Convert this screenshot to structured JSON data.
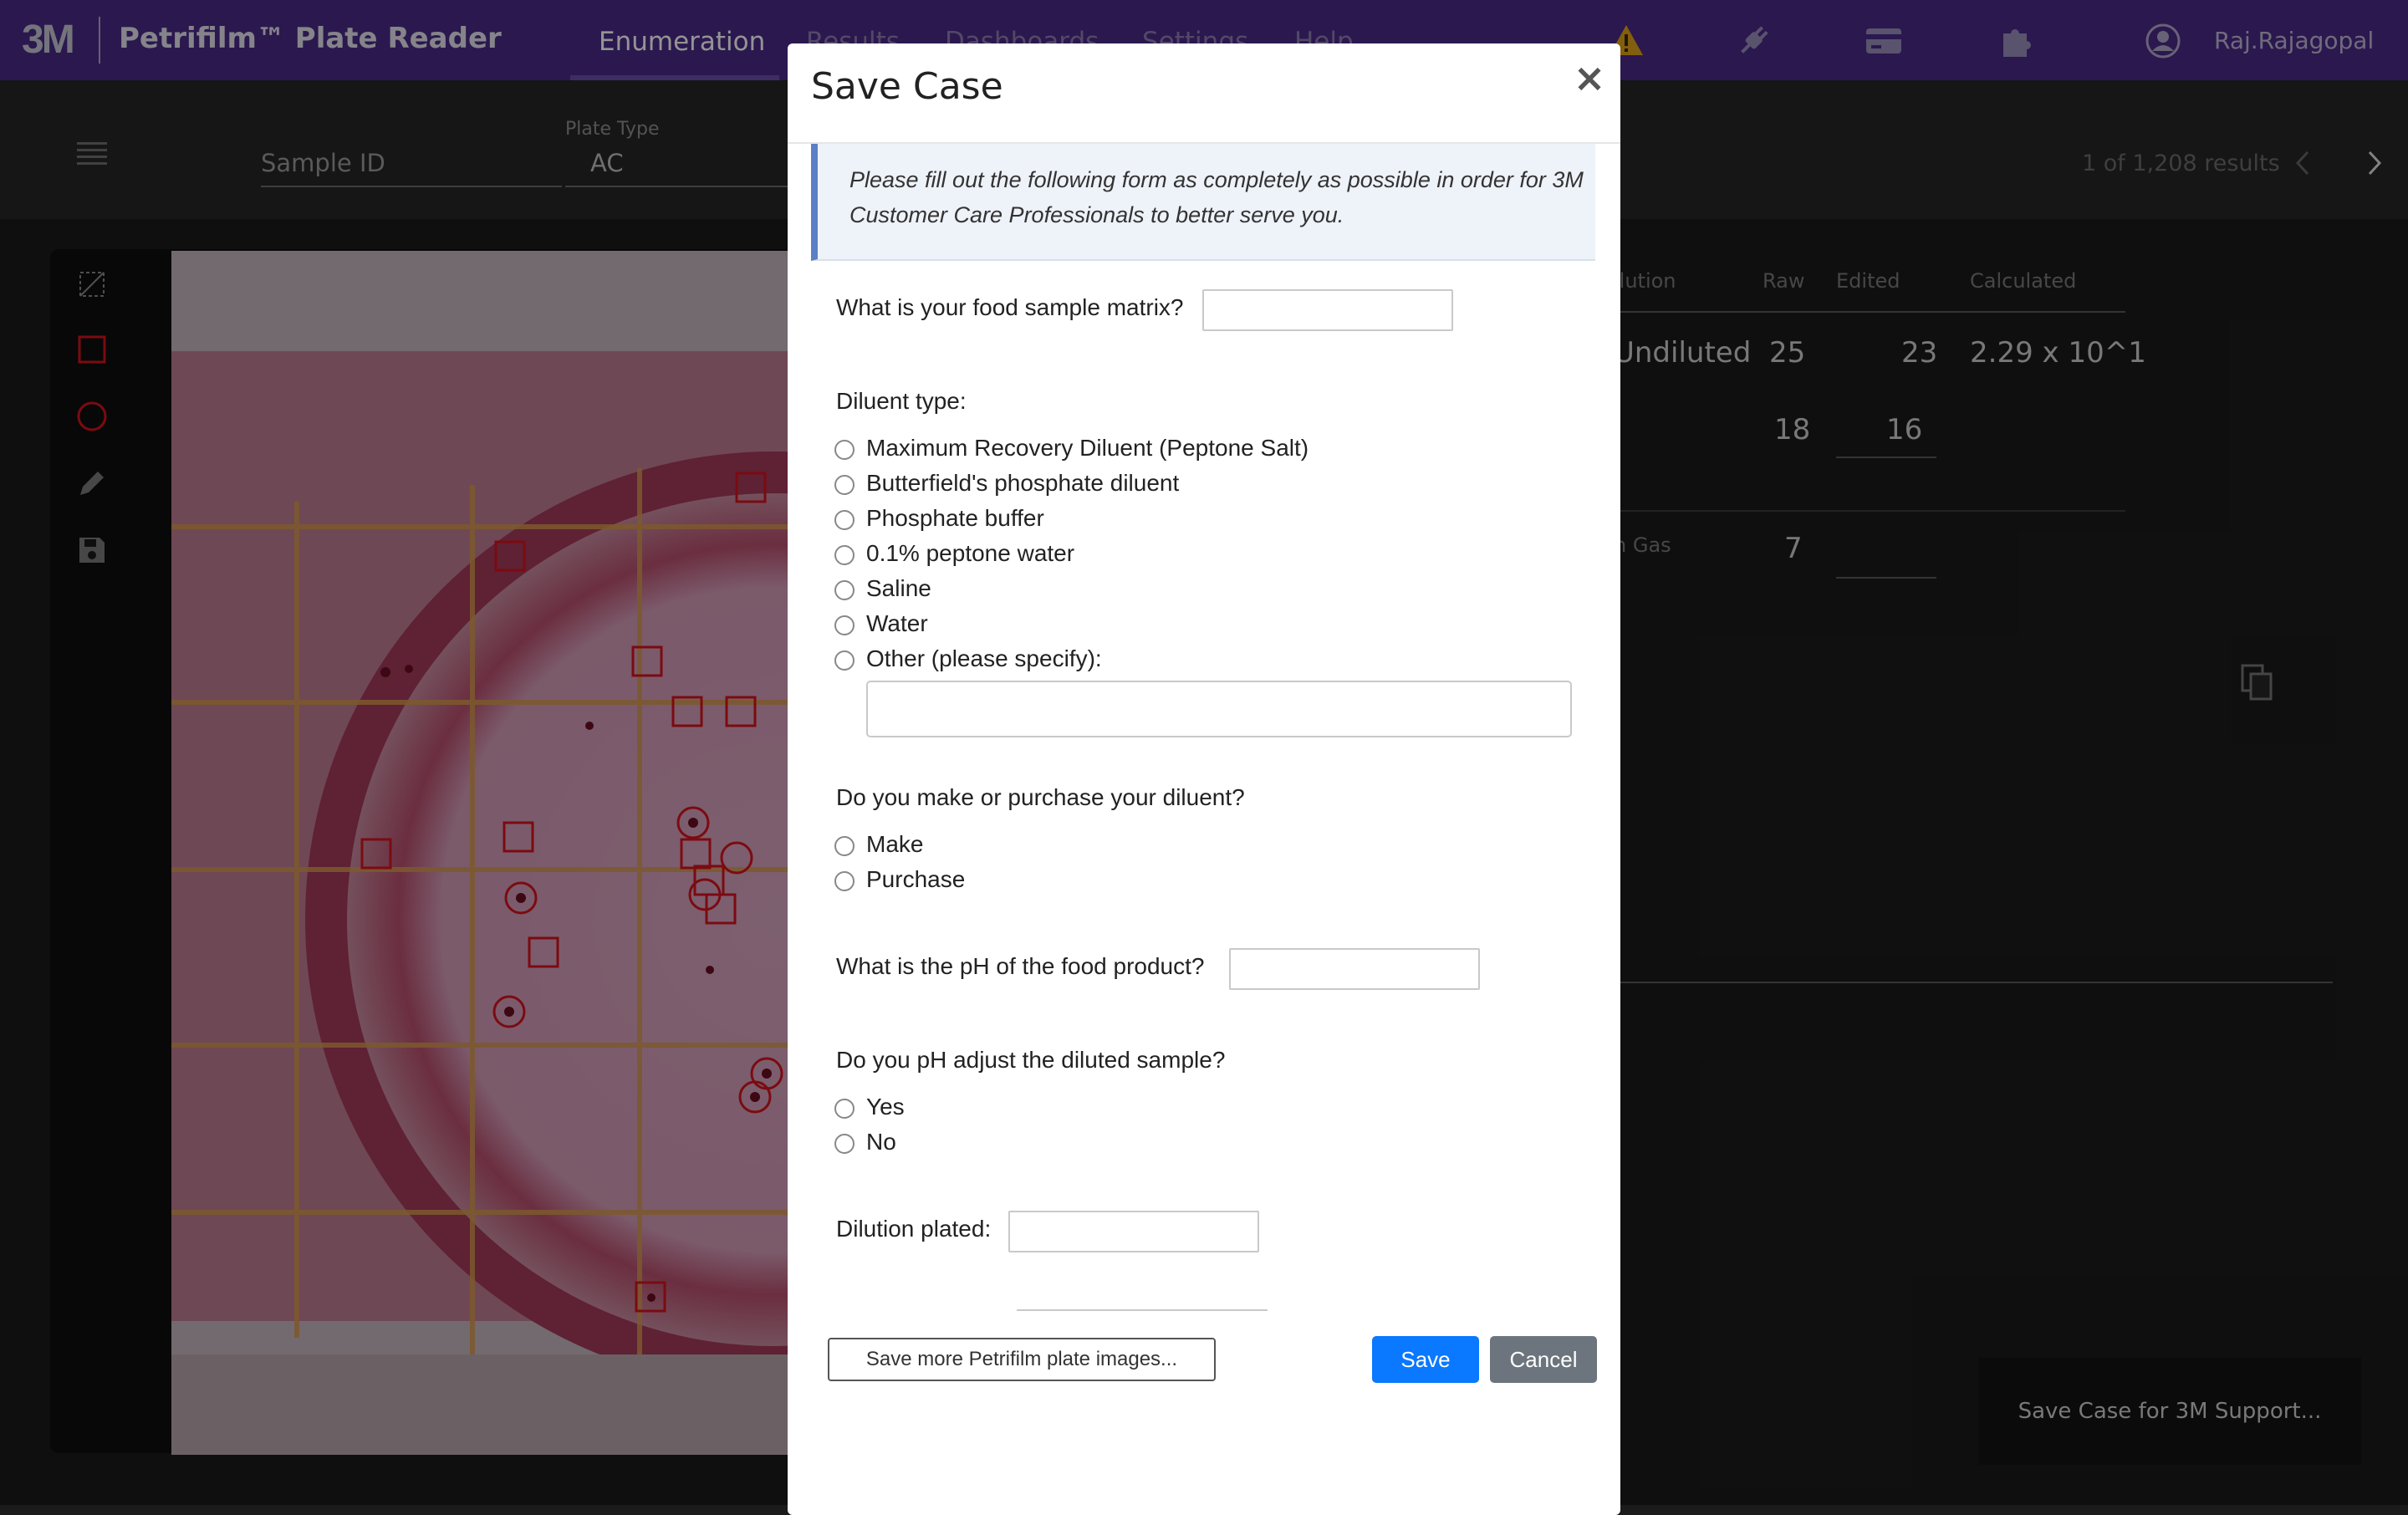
{
  "header": {
    "brand": "3M",
    "app_title": "Petrifilm™ Plate Reader",
    "nav": [
      "Enumeration",
      "Results",
      "Dashboards",
      "Settings",
      "Help"
    ],
    "active_nav": "Enumeration",
    "user": "Raj.Rajagopal",
    "icons": [
      "warning-icon",
      "plug-icon",
      "card-icon",
      "puzzle-icon",
      "user-circle-icon"
    ]
  },
  "toolbar": {
    "sample_id_placeholder": "Sample ID",
    "plate_type_label": "Plate Type",
    "plate_type_value": "AC",
    "results_count": "1 of 1,208 results"
  },
  "background_table": {
    "headers": [
      "ilution",
      "Raw",
      "Edited",
      "Calculated"
    ],
    "row1": {
      "dilution": "Undiluted",
      "raw": "25",
      "edited": "23",
      "calculated": "2.29 x 10^1"
    },
    "row2": {
      "raw": "18",
      "edited": "16"
    },
    "row3": {
      "label": "h Gas",
      "raw": "7"
    },
    "save_case_button": "Save Case for 3M Support..."
  },
  "modal": {
    "title": "Save Case",
    "close_glyph": "×",
    "notice": "Please fill out the following form as completely as possible in order for 3M Customer Care Professionals to better serve you.",
    "q_matrix": "What is your food sample matrix?",
    "q_diluent_type": "Diluent type:",
    "diluent_options": [
      "Maximum Recovery Diluent (Peptone Salt)",
      "Butterfield's phosphate diluent",
      "Phosphate buffer",
      "0.1% peptone water",
      "Saline",
      "Water",
      "Other (please specify):"
    ],
    "q_make_purchase": "Do you make or purchase your diluent?",
    "make_purchase_options": [
      "Make",
      "Purchase"
    ],
    "q_ph": "What is the pH of the food product?",
    "q_ph_adjust": "Do you pH adjust the diluted sample?",
    "ph_adjust_options": [
      "Yes",
      "No"
    ],
    "q_dilution": "Dilution plated:",
    "save_more_button": "Save more Petrifilm plate images...",
    "save_button": "Save",
    "cancel_button": "Cancel"
  }
}
